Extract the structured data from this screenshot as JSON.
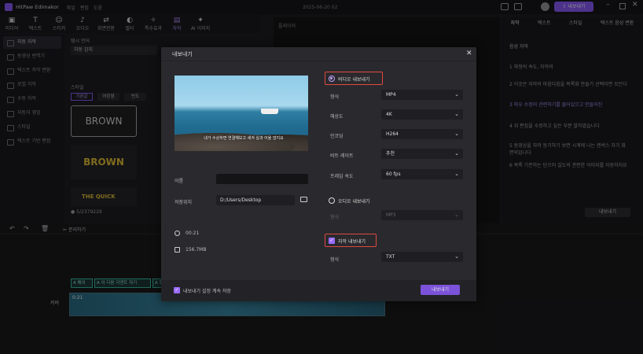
{
  "app": {
    "title": "HitPaw Edimakor",
    "menus": [
      "파일",
      "편집",
      "도움"
    ],
    "date": "2025-06-20 02",
    "export_btn": "내보내기"
  },
  "toolbar": [
    {
      "icon": "media-icon",
      "glyph": "▣",
      "label": "미디어"
    },
    {
      "icon": "text-icon",
      "glyph": "T",
      "label": "텍스트"
    },
    {
      "icon": "sticker-icon",
      "glyph": "☺",
      "label": "스티커"
    },
    {
      "icon": "audio-icon",
      "glyph": "♪",
      "label": "오디오"
    },
    {
      "icon": "transition-icon",
      "glyph": "⇄",
      "label": "화면전환"
    },
    {
      "icon": "filter-icon",
      "glyph": "◐",
      "label": "필터"
    },
    {
      "icon": "effects-icon",
      "glyph": "✧",
      "label": "특수효과"
    },
    {
      "icon": "subtitle-icon",
      "glyph": "▤",
      "label": "자막"
    },
    {
      "icon": "ai-icon",
      "glyph": "✦",
      "label": "AI 이미지"
    }
  ],
  "left_nav": [
    "자동 자막",
    "동영상 번역기",
    "텍스트 자막 변환",
    "로컬 자막",
    "수동 자막",
    "자동자 영업",
    "스타일",
    "텍스트 기반 편집"
  ],
  "bg_panel": {
    "section_title": "템시 언어",
    "lang_value": "자동 감지",
    "style_label": "스타일",
    "style_tabs": [
      "기본값",
      "어린형",
      "빈도"
    ],
    "styles": [
      "BROWN",
      "BROWN",
      "THE QUICK"
    ],
    "coins": "5/2379229",
    "player_label": "플레이어"
  },
  "dialog": {
    "title": "내보내기",
    "subtitle_preview": "내가 수상하면 연결해보고 새겨 실과 어울 많지요",
    "name_label": "이름",
    "name_value": "",
    "path_label": "저장위치",
    "path_value": "D:/Users/Desktop",
    "duration": "00:21",
    "size": "156.7MB",
    "video_export_label": "비디오 내보내기",
    "format_label": "형식",
    "format_value": "MP4",
    "quality_label": "해상도",
    "quality_value": "4K",
    "encoder_label": "인코딩",
    "encoder_value": "H264",
    "bitrate_label": "비트 레이트",
    "bitrate_value": "추천",
    "fps_label": "프레임 속도",
    "fps_value": "60  fps",
    "audio_export_label": "오디오 내보내기",
    "audio_format_label": "형식",
    "audio_format_value": "MP3",
    "subtitle_export_label": "자막 내보내기",
    "sub_format_label": "형식",
    "sub_format_value": "TXT",
    "remember_label": "내보내기 설정 계속 저장",
    "export_button": "내보내기"
  },
  "right_panel": {
    "tabs": [
      "자막",
      "텍스트",
      "스타일",
      "텍스트 음성 변환"
    ],
    "section": "음성 자막",
    "steps": [
      "파형의 속도, 자막의",
      "이곳은 자막의 마음다음을 목록화 만들기 선택이면 모든다",
      "마우 수정의 관련하기를 물어있으고 만들어진",
      "위 편집을 수정하고 싶은 부분 말하였습니다",
      "동영상을 자막 동기하기 보면 시계에 나는 캔버스 자기 화면의입니다",
      "목록 기존하는 단으러 길도의 관련한 이미지를 자동하지요"
    ],
    "export_btn": "내보내기"
  },
  "timeline": {
    "tool_split": "분리하기",
    "clip_time": "0:21",
    "track_label": "커버",
    "sub_clips": [
      "A 해이",
      "A 이 다음 지엔트 자기",
      "A 행문",
      "A ..."
    ]
  }
}
